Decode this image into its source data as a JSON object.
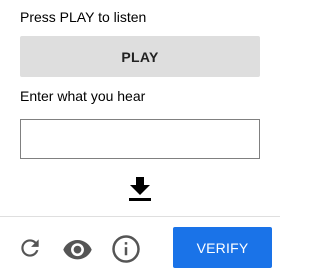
{
  "instructions": {
    "title": "Press PLAY to listen",
    "play_label": "PLAY"
  },
  "response": {
    "label": "Enter what you hear",
    "value": ""
  },
  "icons": {
    "download": "download-icon",
    "reload": "reload-icon",
    "visual_challenge": "eye-icon",
    "help": "info-icon"
  },
  "footer": {
    "verify_label": "VERIFY"
  },
  "colors": {
    "verify_button": "#1a73e8",
    "play_button": "#dedede",
    "icon": "#555555"
  }
}
